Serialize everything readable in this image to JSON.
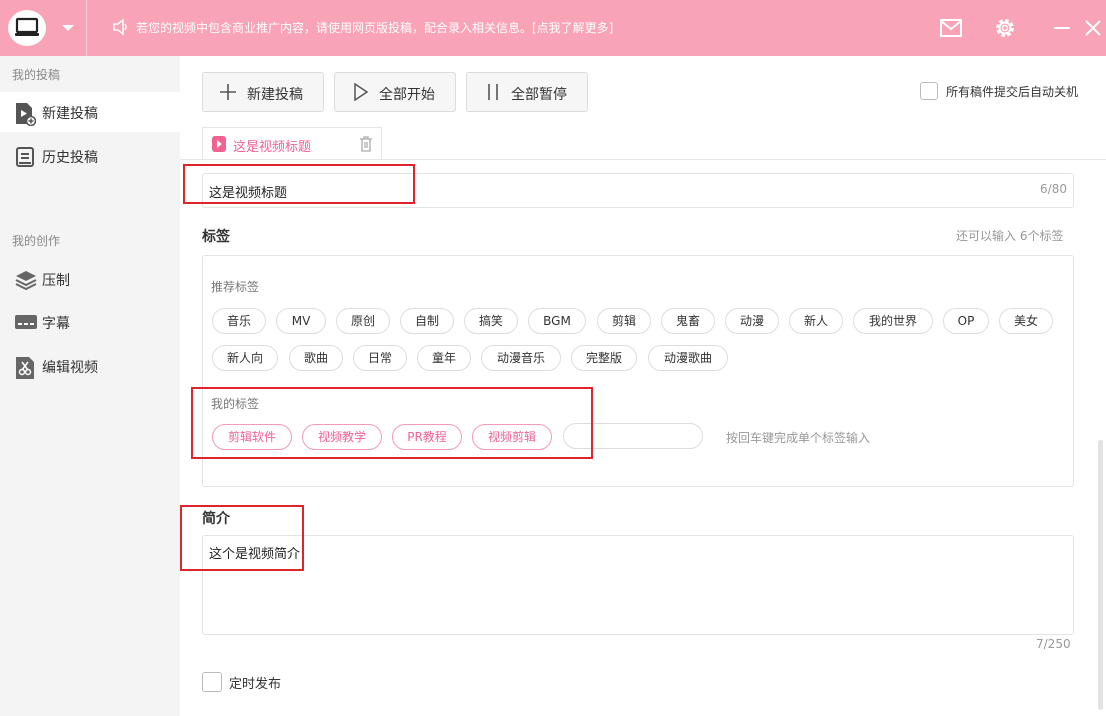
{
  "topbar": {
    "notice": "若您的视频中包含商业推广内容，请使用网页版投稿，配合录入相关信息。[点我了解更多]",
    "icons": [
      "app-logo-icon",
      "dropdown-caret-icon",
      "speaker-icon",
      "mail-icon",
      "gear-icon",
      "minimize-icon",
      "close-icon"
    ]
  },
  "sidebar": {
    "section1": "我的投稿",
    "items1": [
      {
        "label": "新建投稿",
        "icon": "new-upload-icon"
      },
      {
        "label": "历史投稿",
        "icon": "history-icon"
      }
    ],
    "section2": "我的创作",
    "items2": [
      {
        "label": "压制",
        "icon": "layers-icon"
      },
      {
        "label": "字幕",
        "icon": "subtitle-icon"
      },
      {
        "label": "编辑视频",
        "icon": "edit-video-icon"
      }
    ]
  },
  "toolbar": {
    "new_label": "新建投稿",
    "start_all_label": "全部开始",
    "pause_all_label": "全部暂停",
    "auto_shutdown_label": "所有稿件提交后自动关机"
  },
  "tab": {
    "label": "这是视频标题"
  },
  "title": {
    "value": "这是视频标题",
    "count": "6/80"
  },
  "tags": {
    "heading": "标签",
    "remaining": "还可以输入 6个标签",
    "recommended_label": "推荐标签",
    "recommended": [
      "音乐",
      "MV",
      "原创",
      "自制",
      "搞笑",
      "BGM",
      "剪辑",
      "鬼畜",
      "动漫",
      "新人",
      "我的世界",
      "OP",
      "美女",
      "新人向",
      "歌曲",
      "日常",
      "童年",
      "动漫音乐",
      "完整版",
      "动漫歌曲"
    ],
    "my_label": "我的标签",
    "mine": [
      "剪辑软件",
      "视频教学",
      "PR教程",
      "视频剪辑"
    ],
    "input_hint": "按回车键完成单个标签输入"
  },
  "intro": {
    "heading": "简介",
    "value": "这个是视频简介",
    "count": "7/250"
  },
  "schedule": {
    "label": "定时发布"
  },
  "colors": {
    "accent": "#f9a3b6",
    "pink_text": "#f06292",
    "annotation_red": "#e0242b"
  }
}
